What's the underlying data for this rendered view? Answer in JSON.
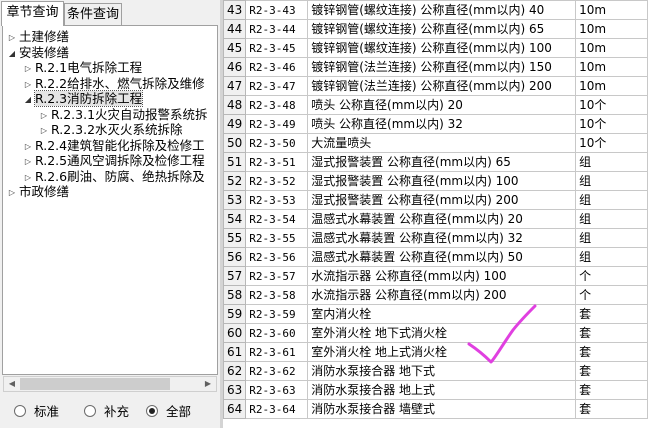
{
  "tabs": {
    "chapter_query": "章节查询",
    "condition_query": "条件查询"
  },
  "tree": [
    {
      "level": 0,
      "expander": "▷",
      "label": "土建修缮"
    },
    {
      "level": 0,
      "expander": "◢",
      "label": "安装修缮"
    },
    {
      "level": 1,
      "expander": "▷",
      "label": "R.2.1电气拆除工程"
    },
    {
      "level": 1,
      "expander": "▷",
      "label": "R.2.2给排水、燃气拆除及维修"
    },
    {
      "level": 1,
      "expander": "◢",
      "label": "R.2.3消防拆除工程",
      "selected": true
    },
    {
      "level": 2,
      "expander": "▷",
      "label": "R.2.3.1火灾自动报警系统拆"
    },
    {
      "level": 2,
      "expander": "▷",
      "label": "R.2.3.2水灭火系统拆除"
    },
    {
      "level": 1,
      "expander": "▷",
      "label": "R.2.4建筑智能化拆除及检修工"
    },
    {
      "level": 1,
      "expander": "▷",
      "label": "R.2.5通风空调拆除及检修工程"
    },
    {
      "level": 1,
      "expander": "▷",
      "label": "R.2.6刷油、防腐、绝热拆除及"
    },
    {
      "level": 0,
      "expander": "▷",
      "label": "市政修缮"
    }
  ],
  "filter": {
    "options": [
      "标准",
      "补充",
      "全部"
    ],
    "selected": "全部"
  },
  "table": {
    "rows": [
      {
        "no": "43",
        "code": "R2-3-43",
        "name": "镀锌钢管(螺纹连接) 公称直径(mm以内) 40",
        "unit": "10m"
      },
      {
        "no": "44",
        "code": "R2-3-44",
        "name": "镀锌钢管(螺纹连接) 公称直径(mm以内) 65",
        "unit": "10m"
      },
      {
        "no": "45",
        "code": "R2-3-45",
        "name": "镀锌钢管(螺纹连接) 公称直径(mm以内) 100",
        "unit": "10m"
      },
      {
        "no": "46",
        "code": "R2-3-46",
        "name": "镀锌钢管(法兰连接) 公称直径(mm以内) 150",
        "unit": "10m"
      },
      {
        "no": "47",
        "code": "R2-3-47",
        "name": "镀锌钢管(法兰连接) 公称直径(mm以内) 200",
        "unit": "10m"
      },
      {
        "no": "48",
        "code": "R2-3-48",
        "name": "喷头 公称直径(mm以内) 20",
        "unit": "10个"
      },
      {
        "no": "49",
        "code": "R2-3-49",
        "name": "喷头 公称直径(mm以内) 32",
        "unit": "10个"
      },
      {
        "no": "50",
        "code": "R2-3-50",
        "name": "大流量喷头",
        "unit": "10个"
      },
      {
        "no": "51",
        "code": "R2-3-51",
        "name": "湿式报警装置 公称直径(mm以内) 65",
        "unit": "组"
      },
      {
        "no": "52",
        "code": "R2-3-52",
        "name": "湿式报警装置 公称直径(mm以内) 100",
        "unit": "组"
      },
      {
        "no": "53",
        "code": "R2-3-53",
        "name": "湿式报警装置 公称直径(mm以内) 200",
        "unit": "组"
      },
      {
        "no": "54",
        "code": "R2-3-54",
        "name": "温感式水幕装置 公称直径(mm以内) 20",
        "unit": "组"
      },
      {
        "no": "55",
        "code": "R2-3-55",
        "name": "温感式水幕装置 公称直径(mm以内) 32",
        "unit": "组"
      },
      {
        "no": "56",
        "code": "R2-3-56",
        "name": "温感式水幕装置 公称直径(mm以内) 50",
        "unit": "组"
      },
      {
        "no": "57",
        "code": "R2-3-57",
        "name": "水流指示器 公称直径(mm以内) 100",
        "unit": "个"
      },
      {
        "no": "58",
        "code": "R2-3-58",
        "name": "水流指示器 公称直径(mm以内) 200",
        "unit": "个"
      },
      {
        "no": "59",
        "code": "R2-3-59",
        "name": "室内消火栓",
        "unit": "套"
      },
      {
        "no": "60",
        "code": "R2-3-60",
        "name": "室外消火栓 地下式消火栓",
        "unit": "套"
      },
      {
        "no": "61",
        "code": "R2-3-61",
        "name": "室外消火栓 地上式消火栓",
        "unit": "套"
      },
      {
        "no": "62",
        "code": "R2-3-62",
        "name": "消防水泵接合器 地下式",
        "unit": "套"
      },
      {
        "no": "63",
        "code": "R2-3-63",
        "name": "消防水泵接合器 地上式",
        "unit": "套"
      },
      {
        "no": "64",
        "code": "R2-3-64",
        "name": "消防水泵接合器 墙壁式",
        "unit": "套"
      }
    ]
  },
  "annotation": {
    "checkmark_color": "#e040e0"
  }
}
